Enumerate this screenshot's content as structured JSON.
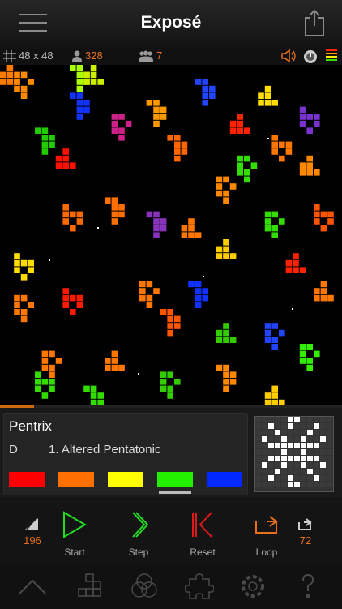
{
  "nav": {
    "title": "Exposé"
  },
  "status": {
    "grid_size": "48 x 48",
    "population": "328",
    "groups": "7"
  },
  "progress_fraction": 0.1,
  "pattern": {
    "name": "Pentrix",
    "key": "D",
    "scale": "1. Altered Pentatonic"
  },
  "swatches": [
    "#ff0000",
    "#ff7000",
    "#ffff00",
    "#22ee00",
    "#0028ff"
  ],
  "selected_swatch": 3,
  "controls": {
    "speed_value": "196",
    "start_label": "Start",
    "step_label": "Step",
    "reset_label": "Reset",
    "loop_label": "Loop",
    "loop_value": "72"
  },
  "colors": {
    "accent": "#e8701a",
    "green": "#22dd22",
    "red": "#dd1a1a"
  }
}
